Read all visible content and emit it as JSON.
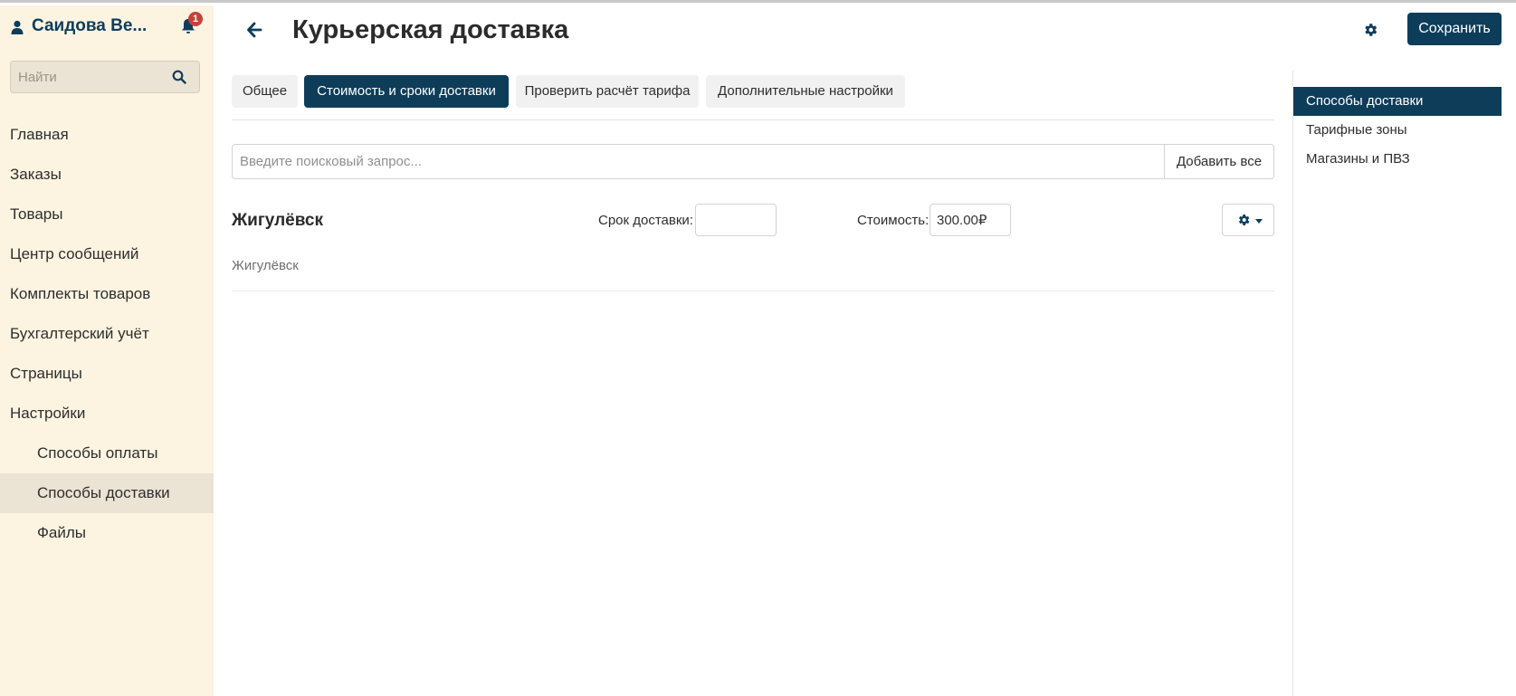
{
  "sidebar": {
    "user_name": "Саидова Ве...",
    "notification_count": "1",
    "search_placeholder": "Найти",
    "items": [
      {
        "label": "Главная",
        "sub": false,
        "active": false
      },
      {
        "label": "Заказы",
        "sub": false,
        "active": false
      },
      {
        "label": "Товары",
        "sub": false,
        "active": false
      },
      {
        "label": "Центр сообщений",
        "sub": false,
        "active": false
      },
      {
        "label": "Комплекты товаров",
        "sub": false,
        "active": false
      },
      {
        "label": "Бухгалтерский учёт",
        "sub": false,
        "active": false
      },
      {
        "label": "Страницы",
        "sub": false,
        "active": false
      },
      {
        "label": "Настройки",
        "sub": false,
        "active": false
      },
      {
        "label": "Способы оплаты",
        "sub": true,
        "active": false
      },
      {
        "label": "Способы доставки",
        "sub": true,
        "active": true
      },
      {
        "label": "Файлы",
        "sub": true,
        "active": false
      }
    ]
  },
  "header": {
    "title": "Курьерская доставка",
    "save_label": "Сохранить"
  },
  "tabs": [
    {
      "label": "Общее",
      "active": false
    },
    {
      "label": "Стоимость и сроки доставки",
      "active": true
    },
    {
      "label": "Проверить расчёт тарифа",
      "active": false
    },
    {
      "label": "Дополнительные настройки",
      "active": false
    }
  ],
  "search": {
    "placeholder": "Введите поисковый запрос...",
    "add_all_label": "Добавить все"
  },
  "city": {
    "title": "Жигулёвск",
    "subtitle": "Жигулёвск",
    "term_label": "Срок доставки:",
    "term_value": "",
    "cost_label": "Стоимость:",
    "cost_value": "300.00₽"
  },
  "right_panel": {
    "items": [
      {
        "label": "Способы доставки",
        "active": true
      },
      {
        "label": "Тарифные зоны",
        "active": false
      },
      {
        "label": "Магазины и ПВЗ",
        "active": false
      }
    ]
  },
  "colors": {
    "primary": "#0e3d5a",
    "sidebar_bg": "#fcf4e1",
    "badge": "#c9403a"
  }
}
